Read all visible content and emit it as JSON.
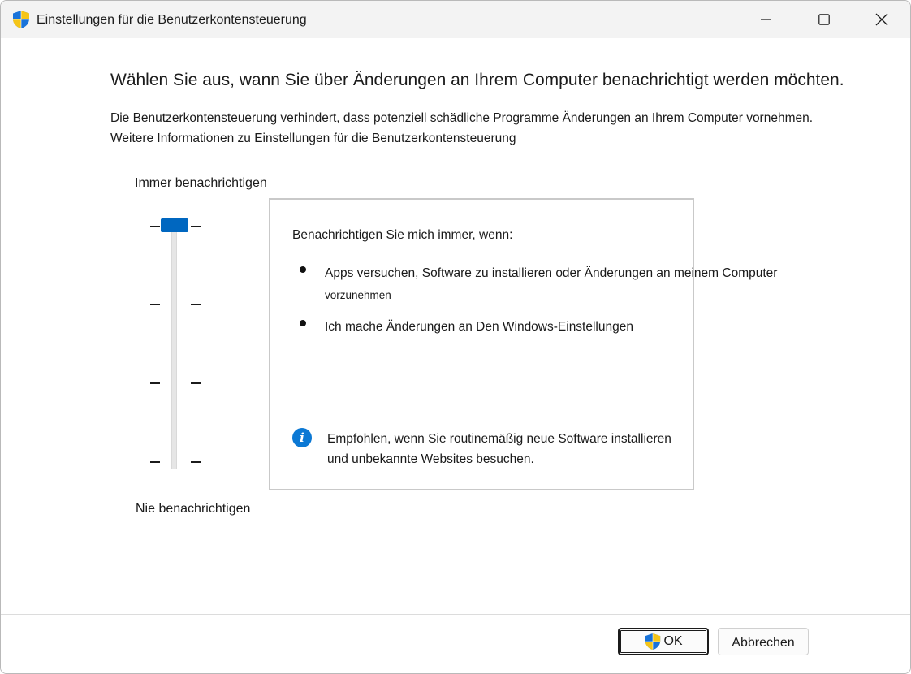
{
  "window": {
    "title": "Einstellungen für die Benutzerkontensteuerung"
  },
  "main": {
    "heading": "Wählen Sie aus, wann Sie über Änderungen an Ihrem Computer benachrichtigt werden möchten.",
    "description": "Die Benutzerkontensteuerung verhindert, dass potenziell schädliche Programme Änderungen an Ihrem Computer vornehmen.",
    "learn_more": "Weitere Informationen zu Einstellungen für die Benutzerkontensteuerung"
  },
  "slider": {
    "label_top": "Immer benachrichtigen",
    "label_bottom": "Nie benachrichtigen",
    "levels": 4,
    "selected_level": 4
  },
  "info_box": {
    "title": "Benachrichtigen Sie mich immer, wenn:",
    "bullets": [
      {
        "text": "Apps versuchen, Software zu installieren oder Änderungen an meinem Computer",
        "continuation": "vorzunehmen"
      },
      {
        "text": "Ich mache Änderungen an Den Windows-Einstellungen"
      }
    ],
    "recommendation_line1": "Empfohlen, wenn Sie routinemäßig neue Software installieren",
    "recommendation_line2": "und unbekannte Websites besuchen."
  },
  "footer": {
    "ok_label": "OK",
    "cancel_label": "Abbrechen"
  },
  "colors": {
    "accent": "#0067c0",
    "info": "#0b78d4",
    "shield_blue": "#1a73d9",
    "shield_yellow": "#f5c518"
  },
  "icons": {
    "title": "uac-shield-icon",
    "ok": "uac-shield-icon",
    "info": "info-icon"
  }
}
